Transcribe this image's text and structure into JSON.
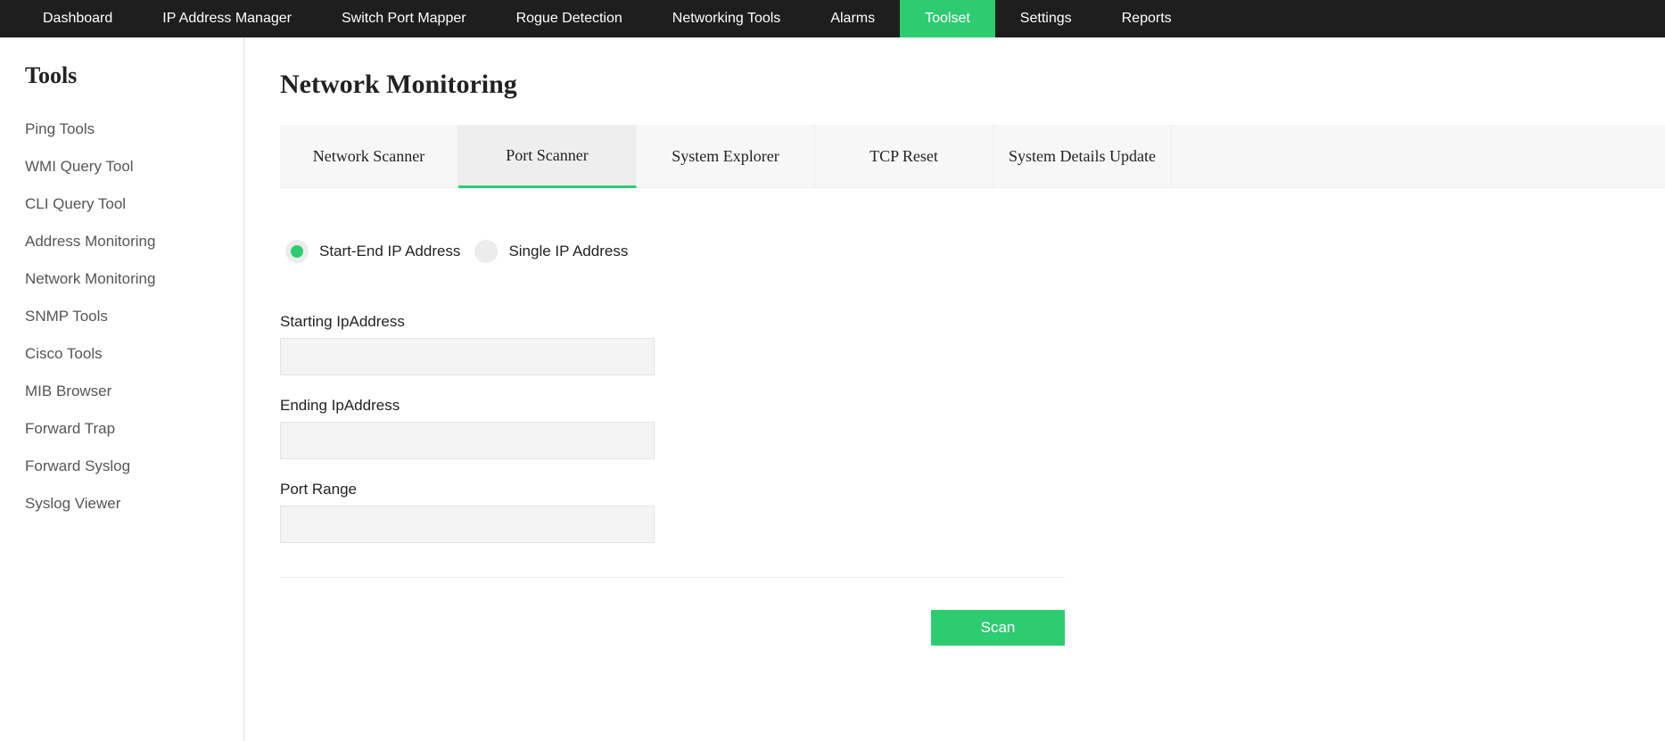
{
  "topnav": [
    {
      "label": "Dashboard",
      "active": false
    },
    {
      "label": "IP Address Manager",
      "active": false
    },
    {
      "label": "Switch Port Mapper",
      "active": false
    },
    {
      "label": "Rogue Detection",
      "active": false
    },
    {
      "label": "Networking Tools",
      "active": false
    },
    {
      "label": "Alarms",
      "active": false
    },
    {
      "label": "Toolset",
      "active": true
    },
    {
      "label": "Settings",
      "active": false
    },
    {
      "label": "Reports",
      "active": false
    }
  ],
  "sidebar": {
    "title": "Tools",
    "items": [
      "Ping Tools",
      "WMI Query Tool",
      "CLI Query Tool",
      "Address Monitoring",
      "Network Monitoring",
      "SNMP Tools",
      "Cisco Tools",
      "MIB Browser",
      "Forward Trap",
      "Forward Syslog",
      "Syslog Viewer"
    ]
  },
  "page": {
    "title": "Network Monitoring"
  },
  "tabs": [
    {
      "label": "Network Scanner",
      "active": false
    },
    {
      "label": "Port Scanner",
      "active": true
    },
    {
      "label": "System Explorer",
      "active": false
    },
    {
      "label": "TCP Reset",
      "active": false
    },
    {
      "label": "System Details Update",
      "active": false
    }
  ],
  "radio": {
    "option1": "Start-End IP Address",
    "option2": "Single IP Address",
    "selected": "option1"
  },
  "fields": {
    "starting_ip": {
      "label": "Starting IpAddress",
      "value": ""
    },
    "ending_ip": {
      "label": "Ending IpAddress",
      "value": ""
    },
    "port_range": {
      "label": "Port Range",
      "value": ""
    }
  },
  "actions": {
    "scan": "Scan"
  }
}
